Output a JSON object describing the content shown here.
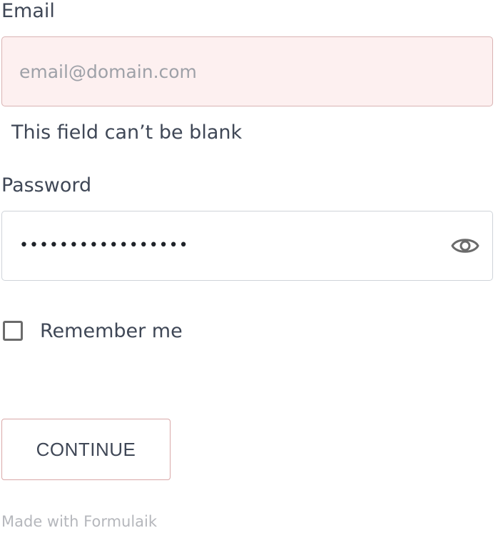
{
  "email": {
    "label": "Email",
    "placeholder": "email@domain.com",
    "value": "",
    "error": "This field can’t be blank"
  },
  "password": {
    "label": "Password",
    "masked_value": "•••••••••••••••••",
    "toggle_icon": "eye-icon"
  },
  "remember": {
    "label": "Remember me",
    "checked": false
  },
  "submit": {
    "label": "CONTINUE"
  },
  "footer": {
    "text": "Made with Formulaik"
  },
  "colors": {
    "error_background": "#fdf0f0",
    "error_border": "#d9b3b3",
    "button_border": "#d9a8a8",
    "text": "#3f4756",
    "muted": "#b5b7bc"
  }
}
